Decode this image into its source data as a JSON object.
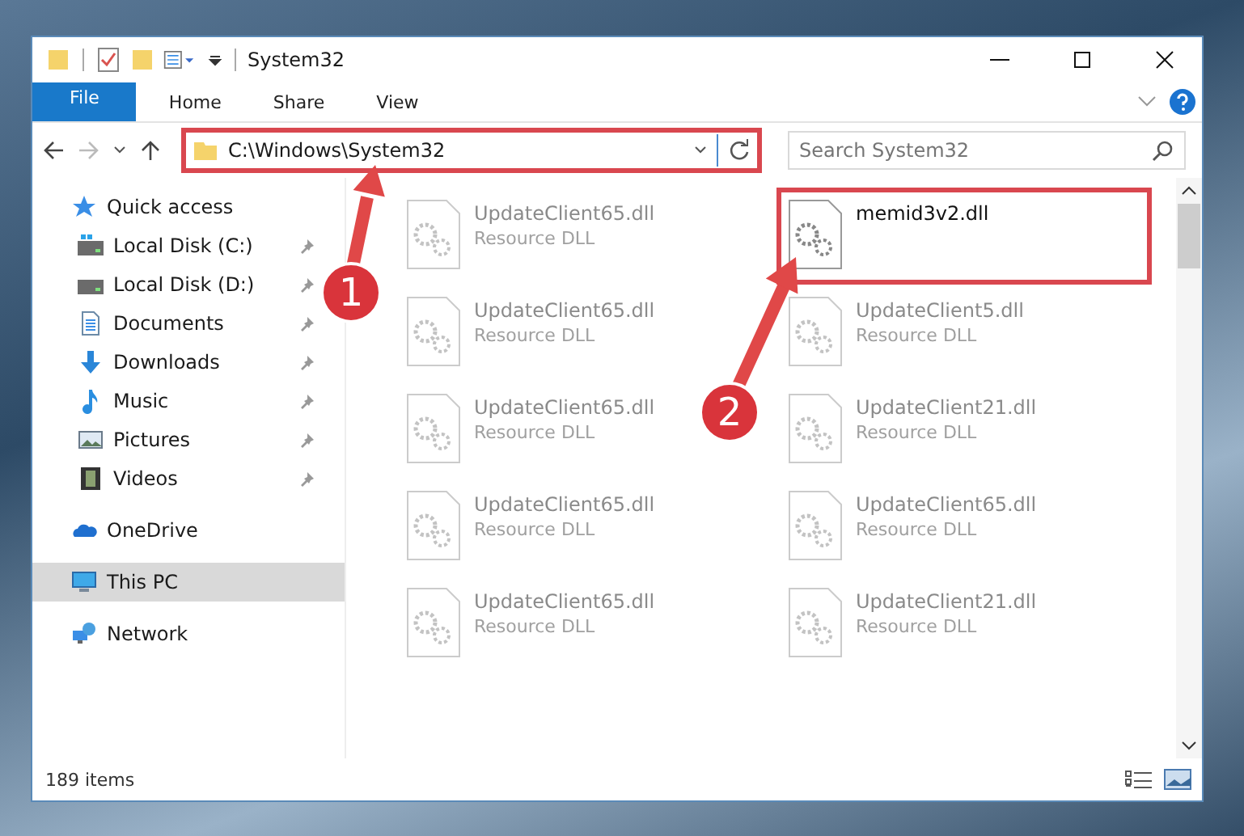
{
  "window": {
    "title": "System32"
  },
  "ribbon_tabs": [
    {
      "label": "File",
      "kind": "file",
      "selected": false
    },
    {
      "label": "Home",
      "kind": "tab",
      "selected": false
    },
    {
      "label": "Share",
      "kind": "tab",
      "selected": false
    },
    {
      "label": "View",
      "kind": "tab",
      "selected": false
    }
  ],
  "address_bar": {
    "value": "C:\\Windows\\System32",
    "highlighted": true
  },
  "search": {
    "placeholder": "Search System32"
  },
  "sidebar": {
    "items": [
      {
        "label": "Quick access",
        "kind": "star",
        "selected": false,
        "children": [
          {
            "label": "Local Disk (C:)",
            "kind": "drive-c",
            "pinned": true,
            "selected": false
          },
          {
            "label": "Local Disk (D:)",
            "kind": "drive",
            "pinned": true,
            "selected": false
          },
          {
            "label": "Documents",
            "kind": "documents",
            "pinned": true,
            "selected": false
          },
          {
            "label": "Downloads",
            "kind": "downloads",
            "pinned": true,
            "selected": false
          },
          {
            "label": "Music",
            "kind": "music",
            "pinned": true,
            "selected": false
          },
          {
            "label": "Pictures",
            "kind": "pictures",
            "pinned": true,
            "selected": false
          },
          {
            "label": "Videos",
            "kind": "videos",
            "pinned": true,
            "selected": false
          }
        ]
      },
      {
        "label": "OneDrive",
        "kind": "cloud",
        "selected": false
      },
      {
        "label": "This PC",
        "kind": "pc",
        "selected": true
      },
      {
        "label": "Network",
        "kind": "network",
        "selected": false
      }
    ]
  },
  "files": [
    {
      "name": "UpdateClient65.dll",
      "type": "Resource DLL",
      "faded": true,
      "highlighted": false
    },
    {
      "name": "memid3v2.dll",
      "faded": false,
      "highlighted": true
    },
    {
      "name": "UpdateClient65.dll",
      "type": "Resource DLL",
      "faded": true,
      "highlighted": false
    },
    {
      "name": "UpdateClient5.dll",
      "type": "Resource DLL",
      "faded": true,
      "highlighted": false
    },
    {
      "name": "UpdateClient65.dll",
      "type": "Resource DLL",
      "faded": true,
      "highlighted": false
    },
    {
      "name": "UpdateClient21.dll",
      "type": "Resource DLL",
      "faded": true,
      "highlighted": false
    },
    {
      "name": "UpdateClient65.dll",
      "type": "Resource DLL",
      "faded": true,
      "highlighted": false
    },
    {
      "name": "UpdateClient65.dll",
      "type": "Resource DLL",
      "faded": true,
      "highlighted": false
    },
    {
      "name": "UpdateClient65.dll",
      "type": "Resource DLL",
      "faded": true,
      "highlighted": false
    },
    {
      "name": "UpdateClient21.dll",
      "type": "Resource DLL",
      "faded": true,
      "highlighted": false
    }
  ],
  "status_bar": {
    "count": "189 items"
  },
  "annotations": [
    {
      "number": "1"
    },
    {
      "number": "2"
    }
  ]
}
